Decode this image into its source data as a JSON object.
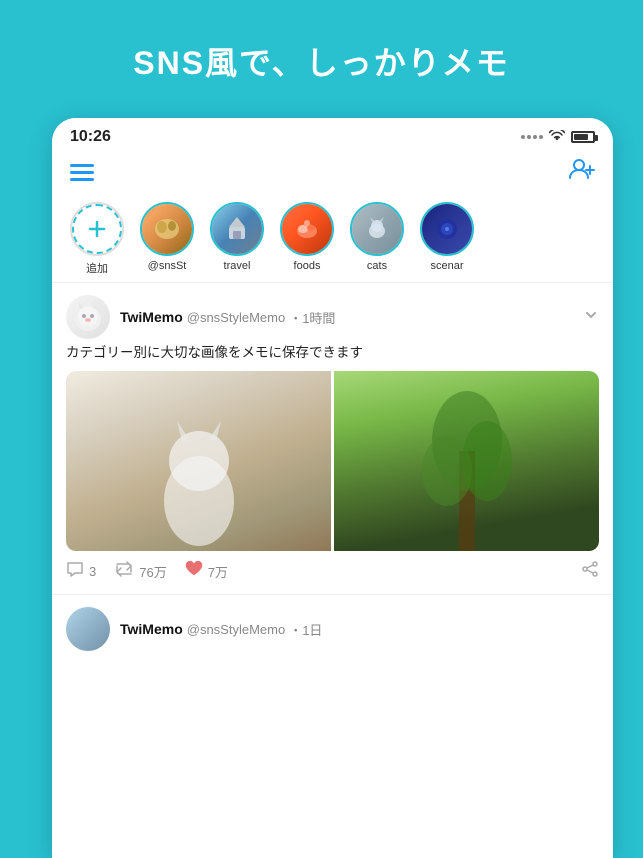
{
  "hero": {
    "title": "SNS風で、しっかりメモ",
    "bg_color": "#29c0d0"
  },
  "status_bar": {
    "time": "10:26",
    "dots": [
      "•",
      "•",
      "•",
      "•"
    ]
  },
  "nav": {
    "add_user_label": "add user"
  },
  "stories": [
    {
      "id": "add",
      "label": "追加",
      "avatar_class": "add-circle"
    },
    {
      "id": "sns",
      "label": "@snsSt",
      "avatar_class": "av-sns"
    },
    {
      "id": "travel",
      "label": "travel",
      "avatar_class": "av-travel"
    },
    {
      "id": "foods",
      "label": "foods",
      "avatar_class": "av-foods"
    },
    {
      "id": "cats",
      "label": "cats",
      "avatar_class": "av-cats"
    },
    {
      "id": "scenar",
      "label": "scenar",
      "avatar_class": "av-scenar"
    }
  ],
  "posts": [
    {
      "id": "post1",
      "name": "TwiMemo",
      "handle": "@snsStyleMemo",
      "time": "・1時間",
      "text": "カテゴリー別に大切な画像をメモに保存できます",
      "has_images": true,
      "actions": {
        "comments": "3",
        "retweets": "76万",
        "likes": "7万"
      }
    },
    {
      "id": "post2",
      "name": "TwiMemo",
      "handle": "@snsStyleMemo",
      "time": "・1日",
      "text": ""
    }
  ]
}
